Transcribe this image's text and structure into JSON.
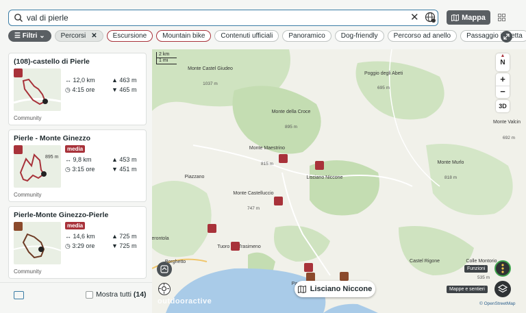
{
  "search": {
    "value": "val di pierle"
  },
  "view_toggle": {
    "map_label": "Mappa"
  },
  "filters": {
    "filter_label": "Filtri",
    "active_label": "Percorsi",
    "chips": [
      "Escursione",
      "Mountain bike",
      "Contenuti ufficiali",
      "Panoramico",
      "Dog-friendly",
      "Percorso ad anello",
      "Passaggio in vetta"
    ]
  },
  "results": [
    {
      "title": "(108)-castello di Pierle",
      "badge": "",
      "distance": "12,0 km",
      "duration": "4:15 ore",
      "ascent": "463 m",
      "descent": "465 m",
      "source": "Community",
      "thumb_label": ""
    },
    {
      "title": "Pierle - Monte Ginezzo",
      "badge": "media",
      "distance": "9,8 km",
      "duration": "3:15 ore",
      "ascent": "453 m",
      "descent": "451 m",
      "source": "Community",
      "thumb_label": "895 m"
    },
    {
      "title": "Pierle-Monte Ginezzo-Pierle",
      "badge": "media",
      "distance": "14,6 km",
      "duration": "3:29 ore",
      "ascent": "725 m",
      "descent": "725 m",
      "source": "Community",
      "thumb_label": ""
    }
  ],
  "footer": {
    "show_all_label": "Mostra tutti",
    "show_all_count": "(14)"
  },
  "map": {
    "scale_km": "2 km",
    "scale_mi": "1 mi",
    "compass": "N",
    "zoom_in": "+",
    "zoom_out": "−",
    "mode_3d": "3D",
    "location_pill": "Lisciano Niccone",
    "functions_label": "Funzioni",
    "layers_label": "Mappe e sentieri",
    "attribution": "© OpenStreetMap",
    "logo": "outdooractive",
    "labels": [
      {
        "name": "Monte Castel Giudeo",
        "elev": "1037 m"
      },
      {
        "name": "Poggio degli Abeti",
        "elev": "695 m"
      },
      {
        "name": "Monte della Croce",
        "elev": "895 m"
      },
      {
        "name": "Monte Maestrino",
        "elev": "815 m"
      },
      {
        "name": "Piazzano",
        "elev": ""
      },
      {
        "name": "Lisciano Niccone",
        "elev": ""
      },
      {
        "name": "Monte Murlo",
        "elev": "818 m"
      },
      {
        "name": "Monte Valcin",
        "elev": "692 m"
      },
      {
        "name": "Monte Castelluccio",
        "elev": "747 m"
      },
      {
        "name": "erontola",
        "elev": ""
      },
      {
        "name": "Tuoro sul Trasimeno",
        "elev": ""
      },
      {
        "name": "Borghetto",
        "elev": ""
      },
      {
        "name": "Castel Rigone",
        "elev": ""
      },
      {
        "name": "Colle Montorio",
        "elev": "535 m"
      },
      {
        "name": "Pa",
        "elev": ""
      }
    ]
  }
}
